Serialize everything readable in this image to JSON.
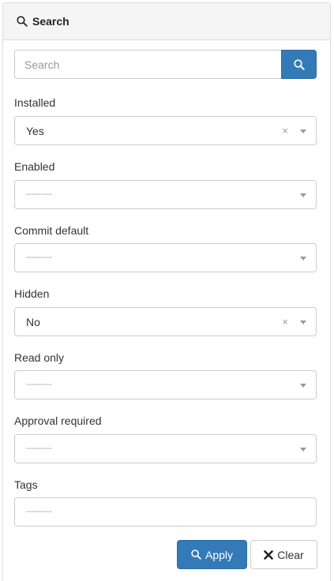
{
  "panel": {
    "title": "Search",
    "title_icon": "search-icon"
  },
  "search": {
    "placeholder": "Search",
    "value": "",
    "button_icon": "search-icon"
  },
  "filters": [
    {
      "label": "Installed",
      "value": "Yes",
      "placeholder": "",
      "clearable": true
    },
    {
      "label": "Enabled",
      "value": "",
      "placeholder": "---------",
      "clearable": false
    },
    {
      "label": "Commit default",
      "value": "",
      "placeholder": "---------",
      "clearable": false
    },
    {
      "label": "Hidden",
      "value": "No",
      "placeholder": "",
      "clearable": true
    },
    {
      "label": "Read only",
      "value": "",
      "placeholder": "---------",
      "clearable": false
    },
    {
      "label": "Approval required",
      "value": "",
      "placeholder": "---------",
      "clearable": false
    }
  ],
  "tags": {
    "label": "Tags",
    "placeholder": "---------"
  },
  "clear_glyph": "×",
  "actions": {
    "apply_label": "Apply",
    "apply_icon": "search-icon",
    "clear_label": "Clear",
    "clear_icon": "close-icon"
  },
  "colors": {
    "primary": "#337ab7",
    "heading_bg": "#f5f5f5",
    "border": "#cccccc"
  }
}
